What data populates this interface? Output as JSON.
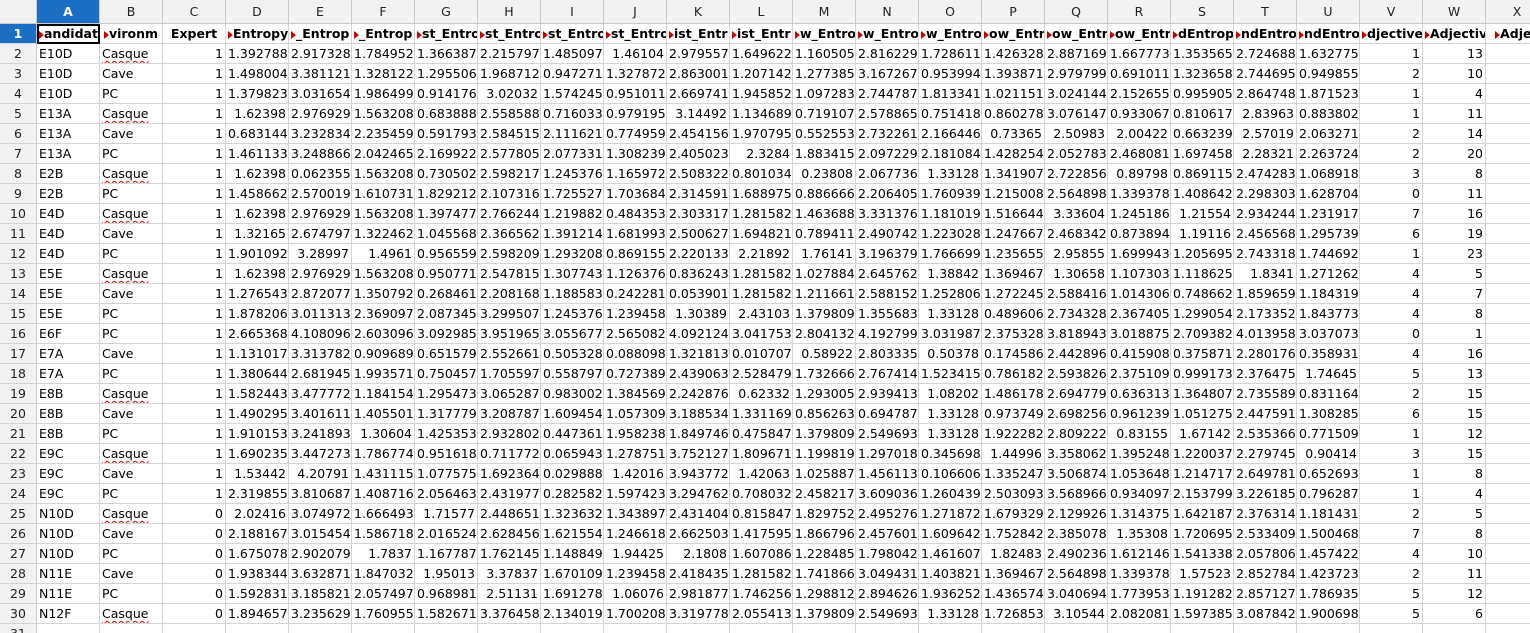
{
  "column_letters": [
    "A",
    "B",
    "C",
    "D",
    "E",
    "F",
    "G",
    "H",
    "I",
    "J",
    "K",
    "L",
    "M",
    "N",
    "O",
    "P",
    "Q",
    "R",
    "S",
    "T",
    "U",
    "V",
    "W",
    "X"
  ],
  "active_cell": "A1",
  "header_row": [
    "andidat",
    "vironm",
    "Expert",
    "Entropy",
    "_Entrop",
    "_Entrop",
    "st_Entro",
    "st_Entro",
    "st_Entro",
    "st_Entro",
    "ist_Entr",
    "ist_Entr",
    "w_Entro",
    "w_Entro",
    "w_Entro",
    "ow_Entr",
    "ow_Entr",
    "ow_Entr",
    "dEntrop",
    "ndEntro",
    "ndEntro",
    "djective",
    "Adjectiv",
    "Adjec"
  ],
  "rows": [
    [
      "E10D",
      "Casque",
      "1",
      "1.392788",
      "2.917328",
      "1.784952",
      "1.366387",
      "2.215797",
      "1.485097",
      "1.46104",
      "2.979557",
      "1.649622",
      "1.160505",
      "2.816229",
      "1.728611",
      "1.426328",
      "2.887169",
      "1.667773",
      "1.353565",
      "2.724688",
      "1.632775",
      "1",
      "13"
    ],
    [
      "E10D",
      "Cave",
      "1",
      "1.498004",
      "3.381121",
      "1.328122",
      "1.295506",
      "1.968712",
      "0.947271",
      "1.327872",
      "2.863001",
      "1.207142",
      "1.277385",
      "3.167267",
      "0.953994",
      "1.393871",
      "2.979799",
      "0.691011",
      "1.323658",
      "2.744695",
      "0.949855",
      "2",
      "10"
    ],
    [
      "E10D",
      "PC",
      "1",
      "1.379823",
      "3.031654",
      "1.986499",
      "0.914176",
      "3.02032",
      "1.574245",
      "0.951011",
      "2.669741",
      "1.945852",
      "1.097283",
      "2.744787",
      "1.813341",
      "1.021151",
      "3.024144",
      "2.152655",
      "0.995905",
      "2.864748",
      "1.871523",
      "1",
      "4"
    ],
    [
      "E13A",
      "Casque",
      "1",
      "1.62398",
      "2.976929",
      "1.563208",
      "0.683888",
      "2.558588",
      "0.716033",
      "0.979195",
      "3.14492",
      "1.134689",
      "0.719107",
      "2.578865",
      "0.751418",
      "0.860278",
      "3.076147",
      "0.933067",
      "0.810617",
      "2.83963",
      "0.883802",
      "1",
      "11"
    ],
    [
      "E13A",
      "Cave",
      "1",
      "0.683144",
      "3.232834",
      "2.235459",
      "0.591793",
      "2.584515",
      "2.111621",
      "0.774959",
      "2.454156",
      "1.970795",
      "0.552553",
      "2.732261",
      "2.166446",
      "0.73365",
      "2.50983",
      "2.00422",
      "0.663239",
      "2.57019",
      "2.063271",
      "2",
      "14"
    ],
    [
      "E13A",
      "PC",
      "1",
      "1.461133",
      "3.248866",
      "2.042465",
      "2.169922",
      "2.577805",
      "2.077331",
      "1.308239",
      "2.405023",
      "2.3284",
      "1.883415",
      "2.097229",
      "2.181084",
      "1.428254",
      "2.052783",
      "2.468081",
      "1.697458",
      "2.28321",
      "2.263724",
      "2",
      "20"
    ],
    [
      "E2B",
      "Casque",
      "1",
      "1.62398",
      "0.062355",
      "1.563208",
      "0.730502",
      "2.598217",
      "1.245376",
      "1.165972",
      "2.508322",
      "0.801034",
      "0.23808",
      "2.067736",
      "1.33128",
      "1.341907",
      "2.722856",
      "0.89798",
      "0.869115",
      "2.474283",
      "1.068918",
      "3",
      "8"
    ],
    [
      "E2B",
      "PC",
      "1",
      "1.458662",
      "2.570019",
      "1.610731",
      "1.829212",
      "2.107316",
      "1.725527",
      "1.703684",
      "2.314591",
      "1.688975",
      "0.886666",
      "2.206405",
      "1.760939",
      "1.215008",
      "2.564898",
      "1.339378",
      "1.408642",
      "2.298303",
      "1.628704",
      "0",
      "11"
    ],
    [
      "E4D",
      "Casque",
      "1",
      "1.62398",
      "2.976929",
      "1.563208",
      "1.397477",
      "2.766244",
      "1.219882",
      "0.484353",
      "2.303317",
      "1.281582",
      "1.463688",
      "3.331376",
      "1.181019",
      "1.516644",
      "3.33604",
      "1.245186",
      "1.21554",
      "2.934244",
      "1.231917",
      "7",
      "16"
    ],
    [
      "E4D",
      "Cave",
      "1",
      "1.32165",
      "2.674797",
      "1.322462",
      "1.045568",
      "2.366562",
      "1.391214",
      "1.681993",
      "2.500627",
      "1.694821",
      "0.789411",
      "2.490742",
      "1.223028",
      "1.247667",
      "2.468342",
      "0.873894",
      "1.19116",
      "2.456568",
      "1.295739",
      "6",
      "19"
    ],
    [
      "E4D",
      "PC",
      "1",
      "1.901092",
      "3.28997",
      "1.4961",
      "0.956559",
      "2.598209",
      "1.293208",
      "0.869155",
      "2.220133",
      "2.21892",
      "1.76141",
      "3.196379",
      "1.766699",
      "1.235655",
      "2.95855",
      "1.699943",
      "1.205695",
      "2.743318",
      "1.744692",
      "1",
      "23"
    ],
    [
      "E5E",
      "Casque",
      "1",
      "1.62398",
      "2.976929",
      "1.563208",
      "0.950771",
      "2.547815",
      "1.307743",
      "1.126376",
      "0.836243",
      "1.281582",
      "1.027884",
      "2.645762",
      "1.38842",
      "1.369467",
      "1.30658",
      "1.107303",
      "1.118625",
      "1.8341",
      "1.271262",
      "4",
      "5"
    ],
    [
      "E5E",
      "Cave",
      "1",
      "1.276543",
      "2.872077",
      "1.350792",
      "0.268461",
      "2.208168",
      "1.188583",
      "0.242281",
      "0.053901",
      "1.281582",
      "1.211661",
      "2.588152",
      "1.252806",
      "1.272245",
      "2.588416",
      "1.014306",
      "0.748662",
      "1.859659",
      "1.184319",
      "4",
      "7"
    ],
    [
      "E5E",
      "PC",
      "1",
      "1.878206",
      "3.011313",
      "2.369097",
      "2.087345",
      "3.299507",
      "1.245376",
      "1.239458",
      "1.30389",
      "2.43103",
      "1.379809",
      "1.355683",
      "1.33128",
      "0.489606",
      "2.734328",
      "2.367405",
      "1.299054",
      "2.173352",
      "1.843773",
      "4",
      "8"
    ],
    [
      "E6F",
      "PC",
      "1",
      "2.665368",
      "4.108096",
      "2.603096",
      "3.092985",
      "3.951965",
      "3.055677",
      "2.565082",
      "4.092124",
      "3.041753",
      "2.804132",
      "4.192799",
      "3.031987",
      "2.375328",
      "3.818943",
      "3.018875",
      "2.709382",
      "4.013958",
      "3.037073",
      "0",
      "1"
    ],
    [
      "E7A",
      "Cave",
      "1",
      "1.131017",
      "3.313782",
      "0.909689",
      "0.651579",
      "2.552661",
      "0.505328",
      "0.088098",
      "1.321813",
      "0.010707",
      "0.58922",
      "2.803335",
      "0.50378",
      "0.174586",
      "2.442896",
      "0.415908",
      "0.375871",
      "2.280176",
      "0.358931",
      "4",
      "16"
    ],
    [
      "E7A",
      "PC",
      "1",
      "1.380644",
      "2.681945",
      "1.993571",
      "0.750457",
      "1.705597",
      "0.558797",
      "0.727389",
      "2.439063",
      "2.528479",
      "1.732666",
      "2.767414",
      "1.523415",
      "0.786182",
      "2.593826",
      "2.375109",
      "0.999173",
      "2.376475",
      "1.74645",
      "5",
      "13"
    ],
    [
      "E8B",
      "Casque",
      "1",
      "1.582443",
      "3.477772",
      "1.184154",
      "1.295473",
      "3.065287",
      "0.983002",
      "1.384569",
      "2.242876",
      "0.62332",
      "1.293005",
      "2.939413",
      "1.08202",
      "1.486178",
      "2.694779",
      "0.636313",
      "1.364807",
      "2.735589",
      "0.831164",
      "2",
      "15"
    ],
    [
      "E8B",
      "Cave",
      "1",
      "1.490295",
      "3.401611",
      "1.405501",
      "1.317779",
      "3.208787",
      "1.609454",
      "1.057309",
      "3.188534",
      "1.331169",
      "0.856263",
      "0.694787",
      "1.33128",
      "0.973749",
      "2.698256",
      "0.961239",
      "1.051275",
      "2.447591",
      "1.308285",
      "6",
      "15"
    ],
    [
      "E8B",
      "PC",
      "1",
      "1.910153",
      "3.241893",
      "1.30604",
      "1.425353",
      "2.932802",
      "0.447361",
      "1.958238",
      "1.849746",
      "0.475847",
      "1.379809",
      "2.549693",
      "1.33128",
      "1.922282",
      "2.809222",
      "0.83155",
      "1.67142",
      "2.535366",
      "0.771509",
      "1",
      "12"
    ],
    [
      "E9C",
      "Casque",
      "1",
      "1.690235",
      "3.447273",
      "1.786774",
      "0.951618",
      "0.711772",
      "0.065943",
      "1.278751",
      "3.752127",
      "1.809671",
      "1.199819",
      "1.297018",
      "0.345698",
      "1.44996",
      "3.358062",
      "1.395248",
      "1.220037",
      "2.279745",
      "0.90414",
      "3",
      "15"
    ],
    [
      "E9C",
      "Cave",
      "1",
      "1.53442",
      "4.20791",
      "1.431115",
      "1.077575",
      "1.692364",
      "0.029888",
      "1.42016",
      "3.943772",
      "1.42063",
      "1.025887",
      "1.456113",
      "0.106606",
      "1.335247",
      "3.506874",
      "1.053648",
      "1.214717",
      "2.649781",
      "0.652693",
      "1",
      "8"
    ],
    [
      "E9C",
      "PC",
      "1",
      "2.319855",
      "3.810687",
      "1.408716",
      "2.056463",
      "2.431977",
      "0.282582",
      "1.597423",
      "3.294762",
      "0.708032",
      "2.458217",
      "3.609036",
      "1.260439",
      "2.503093",
      "3.568966",
      "0.934097",
      "2.153799",
      "3.226185",
      "0.796287",
      "1",
      "4"
    ],
    [
      "N10D",
      "Casque",
      "0",
      "2.02416",
      "3.074972",
      "1.666493",
      "1.71577",
      "2.448651",
      "1.323632",
      "1.343897",
      "2.431404",
      "0.815847",
      "1.829752",
      "2.495276",
      "1.271872",
      "1.679329",
      "2.129926",
      "1.314375",
      "1.642187",
      "2.376314",
      "1.181431",
      "2",
      "5"
    ],
    [
      "N10D",
      "Cave",
      "0",
      "2.188167",
      "3.015454",
      "1.586718",
      "2.016524",
      "2.628456",
      "1.621554",
      "1.246618",
      "2.662503",
      "1.417595",
      "1.866796",
      "2.457601",
      "1.609642",
      "1.752842",
      "2.385078",
      "1.35308",
      "1.720695",
      "2.533409",
      "1.500468",
      "7",
      "8"
    ],
    [
      "N10D",
      "PC",
      "0",
      "1.675078",
      "2.902079",
      "1.7837",
      "1.167787",
      "1.762145",
      "1.148849",
      "1.94425",
      "2.1808",
      "1.607086",
      "1.228485",
      "1.798042",
      "1.461607",
      "1.82483",
      "2.490236",
      "1.612146",
      "1.541338",
      "2.057806",
      "1.457422",
      "4",
      "10"
    ],
    [
      "N11E",
      "Cave",
      "0",
      "1.938344",
      "3.632871",
      "1.847032",
      "1.95013",
      "3.37837",
      "1.670109",
      "1.239458",
      "2.418435",
      "1.281582",
      "1.741866",
      "3.049431",
      "1.403821",
      "1.369467",
      "2.564898",
      "1.339378",
      "1.57523",
      "2.852784",
      "1.423723",
      "2",
      "11"
    ],
    [
      "N11E",
      "PC",
      "0",
      "1.592831",
      "3.185821",
      "2.057497",
      "0.968981",
      "2.51131",
      "1.691278",
      "1.06076",
      "2.981877",
      "1.746256",
      "1.298812",
      "2.894626",
      "1.936252",
      "1.436574",
      "3.040694",
      "1.773953",
      "1.191282",
      "2.857127",
      "1.786935",
      "5",
      "12"
    ],
    [
      "N12F",
      "Casque",
      "0",
      "1.894657",
      "3.235629",
      "1.760955",
      "1.582671",
      "3.376458",
      "2.134019",
      "1.700208",
      "3.319778",
      "2.055413",
      "1.379809",
      "2.549693",
      "1.33128",
      "1.726853",
      "3.10544",
      "2.082081",
      "1.597385",
      "3.087842",
      "1.900698",
      "5",
      "6"
    ]
  ]
}
